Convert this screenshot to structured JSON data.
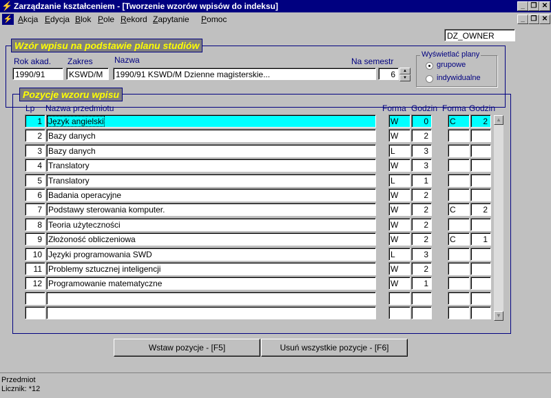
{
  "window": {
    "title": "Zarządzanie kształceniem - [Tworzenie wzorów wpisów do indeksu]"
  },
  "menu": [
    "Akcja",
    "Edycja",
    "Blok",
    "Pole",
    "Rekord",
    "Zapytanie",
    "Pomoc"
  ],
  "user": "DZ_OWNER",
  "header_panel": {
    "title": "Wzór wpisu na podstawie planu studiów",
    "rok_label": "Rok akad.",
    "rok_value": "1990/91",
    "zakres_label": "Zakres",
    "zakres_value": "KSWD/M",
    "nazwa_label": "Nazwa",
    "nazwa_value": "1990/91 KSWD/M Dzienne magisterskie...",
    "semestr_label": "Na semestr",
    "semestr_value": "6",
    "plans_label": "Wyświetlać plany",
    "radio_grupowe": "grupowe",
    "radio_indywidualne": "indywidualne",
    "selected_radio": "grupowe"
  },
  "positions_panel": {
    "title": "Pozycje wzoru wpisu",
    "col_lp": "Lp",
    "col_nazwa": "Nazwa przedmiotu",
    "col_forma1": "Forma",
    "col_godzin1": "Godzin",
    "col_forma2": "Forma",
    "col_godzin2": "Godzin",
    "rows": [
      {
        "lp": "1",
        "name": "Język angielski",
        "f1": "W",
        "g1": "0",
        "f2": "C",
        "g2": "2"
      },
      {
        "lp": "2",
        "name": "Bazy danych",
        "f1": "W",
        "g1": "2",
        "f2": "",
        "g2": ""
      },
      {
        "lp": "3",
        "name": "Bazy danych",
        "f1": "L",
        "g1": "3",
        "f2": "",
        "g2": ""
      },
      {
        "lp": "4",
        "name": "Translatory",
        "f1": "W",
        "g1": "3",
        "f2": "",
        "g2": ""
      },
      {
        "lp": "5",
        "name": "Translatory",
        "f1": "L",
        "g1": "1",
        "f2": "",
        "g2": ""
      },
      {
        "lp": "6",
        "name": "Badania operacyjne",
        "f1": "W",
        "g1": "2",
        "f2": "",
        "g2": ""
      },
      {
        "lp": "7",
        "name": "Podstawy sterowania komputer.",
        "f1": "W",
        "g1": "2",
        "f2": "C",
        "g2": "2"
      },
      {
        "lp": "8",
        "name": "Teoria użyteczności",
        "f1": "W",
        "g1": "2",
        "f2": "",
        "g2": ""
      },
      {
        "lp": "9",
        "name": "Złożoność obliczeniowa",
        "f1": "W",
        "g1": "2",
        "f2": "C",
        "g2": "1"
      },
      {
        "lp": "10",
        "name": "Języki programowania SWD",
        "f1": "L",
        "g1": "3",
        "f2": "",
        "g2": ""
      },
      {
        "lp": "11",
        "name": "Problemy sztucznej inteligencji",
        "f1": "W",
        "g1": "2",
        "f2": "",
        "g2": ""
      },
      {
        "lp": "12",
        "name": "Programowanie matematyczne",
        "f1": "W",
        "g1": "1",
        "f2": "",
        "g2": ""
      },
      {
        "lp": "",
        "name": "",
        "f1": "",
        "g1": "",
        "f2": "",
        "g2": ""
      },
      {
        "lp": "",
        "name": "",
        "f1": "",
        "g1": "",
        "f2": "",
        "g2": ""
      }
    ]
  },
  "buttons": {
    "insert": "Wstaw pozycje - [F5]",
    "delete_all": "Usuń wszystkie pozycje - [F6]"
  },
  "status": {
    "line1": "Przedmiot",
    "line2": "Licznik: *12"
  },
  "colors": {
    "title_bg": "#000080",
    "selected_row": "#00ffff",
    "panel_title_fg": "#ffff00"
  }
}
